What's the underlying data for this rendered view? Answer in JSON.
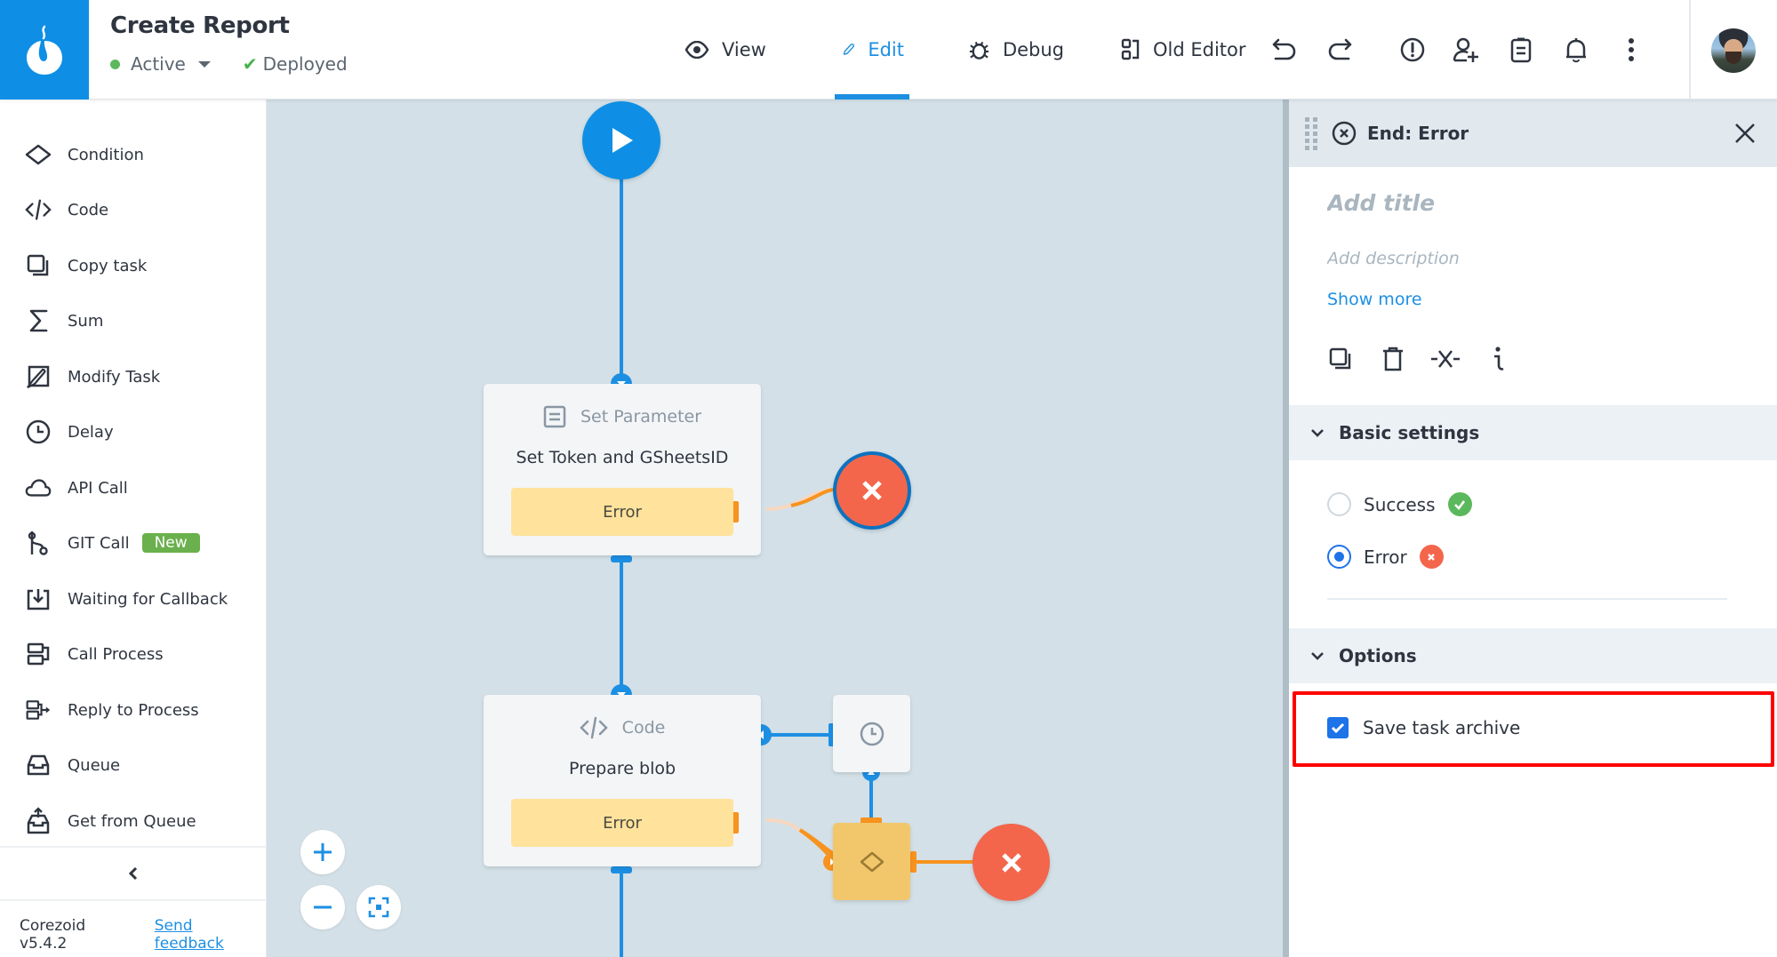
{
  "header": {
    "title": "Create Report",
    "status": "Active",
    "deploy_status": "Deployed",
    "modes": [
      {
        "label": "View",
        "icon": "eye-icon",
        "active": false
      },
      {
        "label": "Edit",
        "icon": "pencil-icon",
        "active": true
      },
      {
        "label": "Debug",
        "icon": "bug-icon",
        "active": false
      },
      {
        "label": "Old Editor",
        "icon": "old-editor-icon",
        "active": false
      }
    ],
    "actions": [
      "undo-icon",
      "redo-icon",
      "alert-icon",
      "add-user-icon",
      "clipboard-icon",
      "bell-icon",
      "more-vertical-icon"
    ]
  },
  "sidebar": {
    "items": [
      {
        "label": "Condition",
        "icon": "diamond-icon"
      },
      {
        "label": "Code",
        "icon": "code-icon"
      },
      {
        "label": "Copy task",
        "icon": "copy-icon"
      },
      {
        "label": "Sum",
        "icon": "sigma-icon"
      },
      {
        "label": "Modify Task",
        "icon": "modify-icon"
      },
      {
        "label": "Delay",
        "icon": "clock-icon"
      },
      {
        "label": "API Call",
        "icon": "cloud-icon"
      },
      {
        "label": "GIT Call",
        "icon": "git-icon",
        "badge": "New"
      },
      {
        "label": "Waiting for Callback",
        "icon": "callback-icon"
      },
      {
        "label": "Call Process",
        "icon": "call-process-icon"
      },
      {
        "label": "Reply to Process",
        "icon": "reply-process-icon"
      },
      {
        "label": "Queue",
        "icon": "queue-icon"
      },
      {
        "label": "Get from Queue",
        "icon": "get-queue-icon"
      }
    ],
    "version": "Corezoid v5.4.2",
    "feedback_link": "Send feedback"
  },
  "canvas": {
    "nodes": [
      {
        "type": "Set Parameter",
        "name": "Set Token and GSheetsID",
        "error_label": "Error"
      },
      {
        "type": "Code",
        "name": "Prepare blob",
        "error_label": "Error"
      }
    ]
  },
  "panel": {
    "title": "End: Error",
    "title_placeholder": "Add title",
    "description_placeholder": "Add description",
    "show_more": "Show more",
    "tools": [
      "copy-icon",
      "delete-icon",
      "disconnect-icon",
      "info-icon"
    ],
    "basic_settings": {
      "label": "Basic settings",
      "options": [
        {
          "label": "Success",
          "selected": false,
          "color": "#5cb85c"
        },
        {
          "label": "Error",
          "selected": true,
          "color": "#f3664c"
        }
      ]
    },
    "options": {
      "label": "Options",
      "save_task_archive": {
        "label": "Save task archive",
        "checked": true
      }
    }
  },
  "colors": {
    "brand": "#0e8fe5",
    "accent": "#1d8fe3",
    "error": "#f3664c",
    "success": "#5cb85c",
    "canvas": "#d3e0e7",
    "highlight": "#ff0000"
  }
}
